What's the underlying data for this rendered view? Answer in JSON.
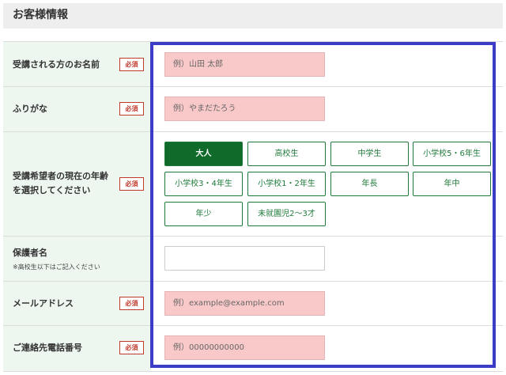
{
  "section": {
    "title": "お客様情報"
  },
  "required_label": "必須",
  "fields": {
    "name": {
      "label": "受講される方のお名前",
      "placeholder": "例）山田 太郎"
    },
    "furigana": {
      "label": "ふりがな",
      "placeholder": "例）やまだたろう"
    },
    "age": {
      "label_line1": "受講希望者の現在の年齢",
      "label_line2": "を選択してください",
      "options": [
        "大人",
        "高校生",
        "中学生",
        "小学校5・6年生",
        "小学校3・4年生",
        "小学校1・2年生",
        "年長",
        "年中",
        "年少",
        "未就園児2〜3才"
      ],
      "selected": "大人"
    },
    "guardian": {
      "label": "保護者名",
      "note": "※高校生以下はご記入ください",
      "value": ""
    },
    "email": {
      "label": "メールアドレス",
      "placeholder": "例）example@example.com"
    },
    "phone": {
      "label": "ご連絡先電話番号",
      "placeholder": "例）00000000000"
    }
  },
  "colors": {
    "accent_green": "#0f6b2a",
    "highlight_blue": "#3c3cc8",
    "input_pink": "#f9c9c9",
    "label_bg": "#eef6f0"
  }
}
